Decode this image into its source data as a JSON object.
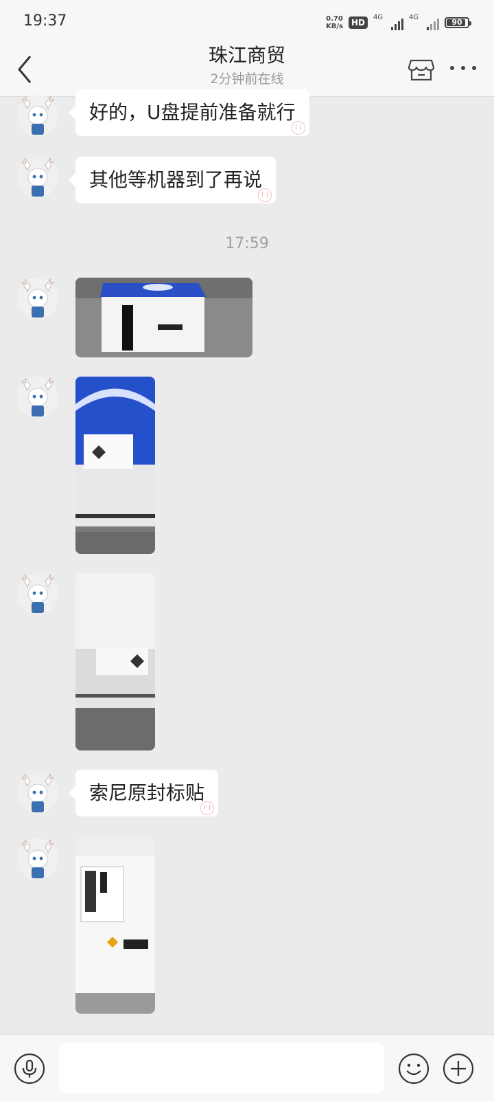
{
  "status_bar": {
    "time": "19:37",
    "net_speed_value": "0.70",
    "net_speed_unit": "KB/s",
    "hd_label": "HD",
    "signal1_label": "4G",
    "signal2_label": "4G",
    "battery_percent": "90"
  },
  "header": {
    "title": "珠江商贸",
    "subtitle": "2分钟前在线"
  },
  "messages": [
    {
      "type": "text",
      "text": "好的，U盘提前准备就行"
    },
    {
      "type": "text",
      "text": "其他等机器到了再说"
    },
    {
      "type": "time",
      "text": "17:59"
    },
    {
      "type": "image",
      "icon": "ps5-box-photo"
    },
    {
      "type": "image",
      "icon": "box-seal-photo"
    },
    {
      "type": "image",
      "icon": "box-seal-photo-2"
    },
    {
      "type": "text",
      "text": "索尼原封标贴"
    },
    {
      "type": "image",
      "icon": "box-label-photo"
    }
  ],
  "input": {
    "placeholder": "",
    "value": ""
  },
  "colors": {
    "background": "#ebebeb",
    "bar": "#f7f7f7",
    "bubble": "#ffffff",
    "text": "#222222",
    "muted": "#999999"
  }
}
